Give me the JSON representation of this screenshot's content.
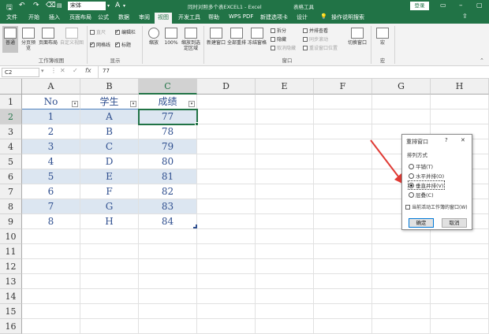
{
  "window": {
    "title": "同时对照多个表EXCEL1 - Excel",
    "context_tab": "表格工具",
    "login_label": "登录",
    "font_name": "宋体"
  },
  "tabs": [
    "文件",
    "开始",
    "插入",
    "页面布局",
    "公式",
    "数据",
    "审阅",
    "视图",
    "开发工具",
    "帮助",
    "WPS PDF",
    "新建选项卡",
    "设计"
  ],
  "active_tab": "视图",
  "search_hint": "操作说明搜索",
  "ribbon": {
    "workbook_views": {
      "label": "工作簿视图",
      "normal": "普通",
      "page_break": "分页预览",
      "page_layout": "页面布局",
      "custom": "自定义视图"
    },
    "show": {
      "label": "显示",
      "ruler": "直尺",
      "gridlines": "网格线",
      "formula_bar": "编辑栏",
      "headings": "标题"
    },
    "zoom": {
      "zoom": "缩放",
      "hundred": "100%",
      "to_selection": "缩放到选定区域"
    },
    "window": {
      "label": "窗口",
      "new_window": "新建窗口",
      "arrange_all": "全部重排",
      "freeze": "冻结窗格",
      "split": "拆分",
      "hide": "隐藏",
      "unhide": "取消隐藏",
      "side_by_side": "并排查看",
      "sync_scroll": "同步滚动",
      "reset_pos": "重设窗口位置",
      "switch": "切换窗口"
    },
    "macros": {
      "label": "宏",
      "macro": "宏"
    }
  },
  "formula": {
    "name_box": "C2",
    "value": "77"
  },
  "columns": [
    "A",
    "B",
    "C",
    "D",
    "E",
    "F",
    "G",
    "H"
  ],
  "rows": [
    "1",
    "2",
    "3",
    "4",
    "5",
    "6",
    "7",
    "8",
    "9",
    "10",
    "11",
    "12",
    "13",
    "14",
    "15",
    "16"
  ],
  "table": {
    "headers": [
      "No",
      "学生",
      "成绩"
    ],
    "data": [
      [
        "1",
        "A",
        "77"
      ],
      [
        "2",
        "B",
        "78"
      ],
      [
        "3",
        "C",
        "79"
      ],
      [
        "4",
        "D",
        "80"
      ],
      [
        "5",
        "E",
        "81"
      ],
      [
        "6",
        "F",
        "82"
      ],
      [
        "7",
        "G",
        "83"
      ],
      [
        "8",
        "H",
        "84"
      ]
    ],
    "filter_glyph": "▾"
  },
  "dialog": {
    "title": "重排窗口",
    "help": "?",
    "close": "✕",
    "group_label": "排列方式",
    "options": [
      "平铺(T)",
      "水平并排(O)",
      "垂直并排(V)",
      "层叠(C)"
    ],
    "selected_index": 2,
    "checkbox_label": "当前活动工作簿的窗口(W)",
    "ok": "确定",
    "cancel": "取消"
  },
  "colors": {
    "excel_green": "#217346",
    "band_blue": "#dce6f1",
    "text_blue": "#2f4f8f",
    "arrow_red": "#e03b35"
  }
}
